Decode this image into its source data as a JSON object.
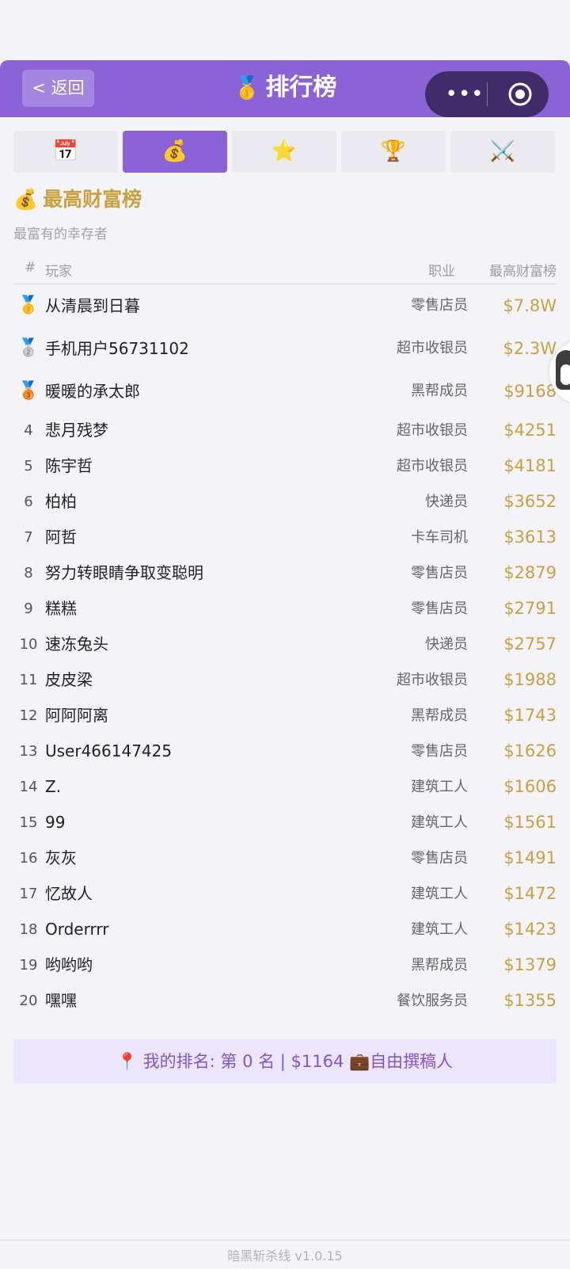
{
  "header": {
    "back_label": "< 返回",
    "title": "排行榜",
    "title_icon": "🥇",
    "more_icon": "•••"
  },
  "tabs": [
    {
      "icon": "📅",
      "name": "calendar-icon",
      "active": false
    },
    {
      "icon": "💰",
      "name": "money-bag-icon",
      "active": true
    },
    {
      "icon": "⭐",
      "name": "star-icon",
      "active": false
    },
    {
      "icon": "🏆",
      "name": "trophy-icon",
      "active": false
    },
    {
      "icon": "⚔️",
      "name": "crossed-swords-icon",
      "active": false
    }
  ],
  "section": {
    "icon": "💰",
    "title": "最高财富榜",
    "subtitle": "最富有的幸存者"
  },
  "table": {
    "columns": {
      "rank": "#",
      "player": "玩家",
      "job": "职业",
      "wealth": "最高财富榜"
    },
    "rows": [
      {
        "rank": "1",
        "medal": "🥇",
        "name": "从清晨到日暮",
        "job": "零售店员",
        "wealth": "$7.8W"
      },
      {
        "rank": "2",
        "medal": "🥈",
        "name": "手机用户56731102",
        "job": "超市收银员",
        "wealth": "$2.3W"
      },
      {
        "rank": "3",
        "medal": "🥉",
        "name": "暖暖的承太郎",
        "job": "黑帮成员",
        "wealth": "$9168"
      },
      {
        "rank": "4",
        "medal": "",
        "name": "悲月残梦",
        "job": "超市收银员",
        "wealth": "$4251"
      },
      {
        "rank": "5",
        "medal": "",
        "name": "陈宇哲",
        "job": "超市收银员",
        "wealth": "$4181"
      },
      {
        "rank": "6",
        "medal": "",
        "name": "柏柏",
        "job": "快递员",
        "wealth": "$3652"
      },
      {
        "rank": "7",
        "medal": "",
        "name": "阿哲",
        "job": "卡车司机",
        "wealth": "$3613"
      },
      {
        "rank": "8",
        "medal": "",
        "name": "努力转眼睛争取变聪明",
        "job": "零售店员",
        "wealth": "$2879"
      },
      {
        "rank": "9",
        "medal": "",
        "name": "糕糕",
        "job": "零售店员",
        "wealth": "$2791"
      },
      {
        "rank": "10",
        "medal": "",
        "name": "速冻兔头",
        "job": "快递员",
        "wealth": "$2757"
      },
      {
        "rank": "11",
        "medal": "",
        "name": "皮皮梁",
        "job": "超市收银员",
        "wealth": "$1988"
      },
      {
        "rank": "12",
        "medal": "",
        "name": "阿阿阿离",
        "job": "黑帮成员",
        "wealth": "$1743"
      },
      {
        "rank": "13",
        "medal": "",
        "name": "User466147425",
        "job": "零售店员",
        "wealth": "$1626"
      },
      {
        "rank": "14",
        "medal": "",
        "name": "Z.",
        "job": "建筑工人",
        "wealth": "$1606"
      },
      {
        "rank": "15",
        "medal": "",
        "name": "99",
        "job": "建筑工人",
        "wealth": "$1561"
      },
      {
        "rank": "16",
        "medal": "",
        "name": "灰灰",
        "job": "零售店员",
        "wealth": "$1491"
      },
      {
        "rank": "17",
        "medal": "",
        "name": "忆故人",
        "job": "建筑工人",
        "wealth": "$1472"
      },
      {
        "rank": "18",
        "medal": "",
        "name": "Orderrrr",
        "job": "建筑工人",
        "wealth": "$1423"
      },
      {
        "rank": "19",
        "medal": "",
        "name": "哟哟哟",
        "job": "黑帮成员",
        "wealth": "$1379"
      },
      {
        "rank": "20",
        "medal": "",
        "name": "嘿嘿",
        "job": "餐饮服务员",
        "wealth": "$1355"
      }
    ]
  },
  "my_rank": {
    "pin_icon": "📍",
    "text": "我的排名: 第 0 名 | $1164",
    "job_icon": "💼",
    "job": "自由撰稿人"
  },
  "footer": {
    "version": "暗黑斩杀线 v1.0.15"
  },
  "colors": {
    "accent": "#8b63d6",
    "gold": "#c9a141",
    "background": "#f4f3f8"
  }
}
